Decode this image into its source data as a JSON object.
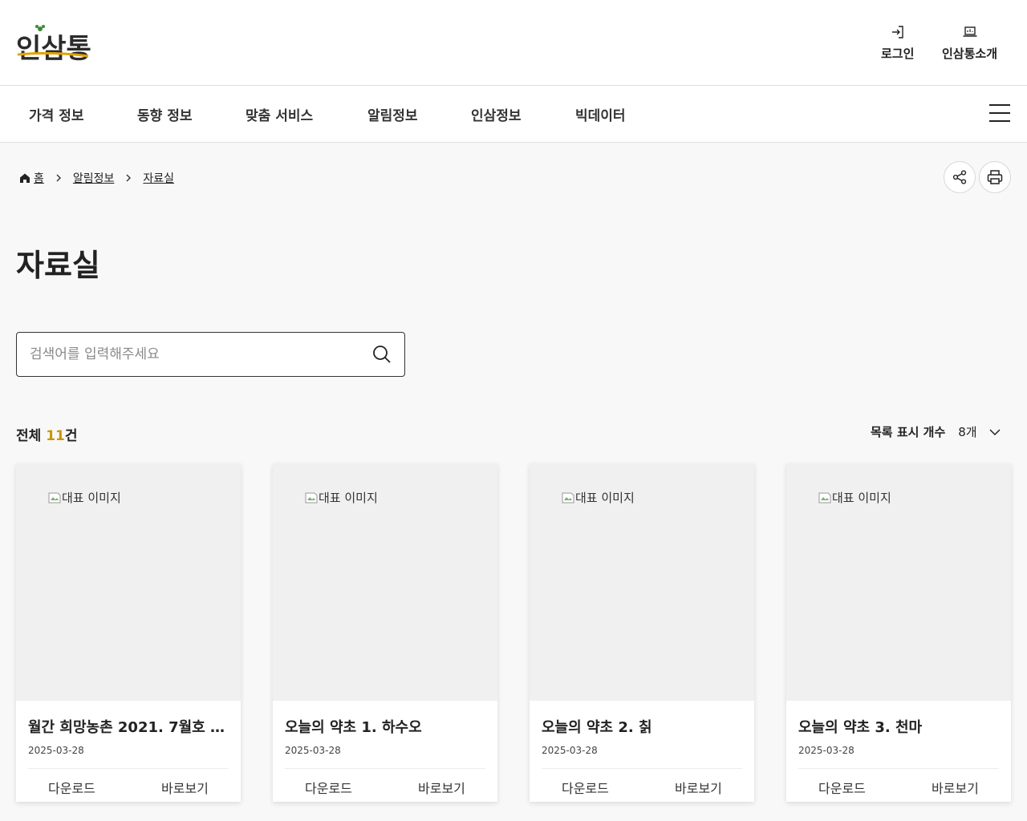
{
  "header": {
    "logo_text": "인삼통",
    "login_label": "로그인",
    "intro_label": "인삼통소개"
  },
  "nav": {
    "items": [
      "가격 정보",
      "동향 정보",
      "맞춤 서비스",
      "알림정보",
      "인삼정보",
      "빅데이터"
    ]
  },
  "breadcrumb": {
    "home": "홈",
    "level1": "알림정보",
    "level2": "자료실"
  },
  "page": {
    "title": "자료실"
  },
  "search": {
    "placeholder": "검색어를 입력해주세요",
    "value": ""
  },
  "list": {
    "total_prefix": "전체 ",
    "total_count": "11",
    "total_suffix": "건",
    "per_page_label": "목록 표시 개수",
    "per_page_value": "8개"
  },
  "cards": [
    {
      "image_alt": "대표 이미지",
      "title": "월간 희망농촌 2021. 7월호 [...",
      "date": "2025-03-28",
      "download_label": "다운로드",
      "view_label": "바로보기"
    },
    {
      "image_alt": "대표 이미지",
      "title": "오늘의 약초 1. 하수오",
      "date": "2025-03-28",
      "download_label": "다운로드",
      "view_label": "바로보기"
    },
    {
      "image_alt": "대표 이미지",
      "title": "오늘의 약초 2. 칡",
      "date": "2025-03-28",
      "download_label": "다운로드",
      "view_label": "바로보기"
    },
    {
      "image_alt": "대표 이미지",
      "title": "오늘의 약초 3. 천마",
      "date": "2025-03-28",
      "download_label": "다운로드",
      "view_label": "바로보기"
    }
  ],
  "colors": {
    "accent": "#c89600",
    "border": "#dedede",
    "thumb_bg": "#f0f0f0"
  },
  "icons": {
    "login": "login-icon",
    "intro": "laptop-icon",
    "menu": "hamburger-icon",
    "home": "home-icon",
    "share": "share-icon",
    "print": "print-icon",
    "search": "search-icon",
    "dropdown": "chevron-down-icon",
    "broken_image": "broken-image-icon"
  }
}
